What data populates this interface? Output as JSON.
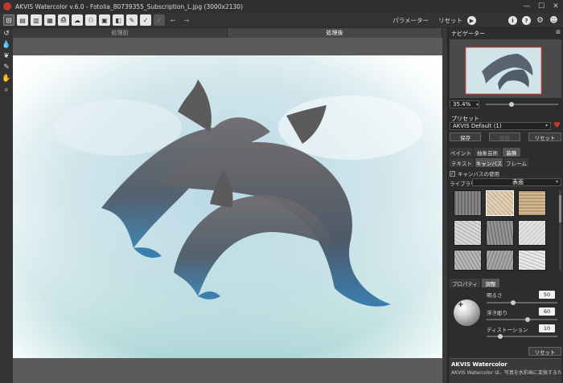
{
  "window": {
    "title": "AKVIS Watercolor v.6.0 - Fotolia_80739355_Subscription_L.jpg (3000x2130)",
    "minimize": "—",
    "maximize": "☐",
    "close": "✕"
  },
  "toolbar": {
    "right_params_label": "パラメーター",
    "right_reset_label": "リセット",
    "run_glyph": "▶",
    "info_glyph": "i",
    "help_glyph": "?",
    "settings_glyph": "⚙",
    "user_glyph": "☻"
  },
  "view_tabs": {
    "before": "処理前",
    "after": "処理後"
  },
  "navigator": {
    "title": "ナビゲーター",
    "zoom_value": "35.4%",
    "zoom_level": 0.34
  },
  "presets": {
    "title": "プリセット",
    "selected": "AKVIS Default (1)",
    "save_label": "保存",
    "delete_label": "削除",
    "reset_label": "リセット"
  },
  "tabs_top": [
    "ペイント",
    "抽象芸術",
    "装飾"
  ],
  "tabs_sub": [
    "テキスト",
    "キャンバス",
    "フレーム"
  ],
  "canvas": {
    "use_canvas_label": "キャンバスの使用",
    "use_canvas_checked": true,
    "library_label": "ライブラリ",
    "library_value": "表面"
  },
  "texture_props": {
    "tab_properties": "プロパティ",
    "tab_adjust": "調整",
    "brightness_label": "明るさ",
    "brightness_value": "50",
    "relief_label": "浮き彫り",
    "relief_value": "60",
    "distortion_label": "ディストーション",
    "distortion_value": "10",
    "reset_label": "リセット"
  },
  "help": {
    "title": "AKVIS Watercolor",
    "text": "AKVIS Watercolor は、写真を水彩画に変換するための 芸術的なツールです。このソフトウェアを使用すれば、瞬間的に写"
  }
}
